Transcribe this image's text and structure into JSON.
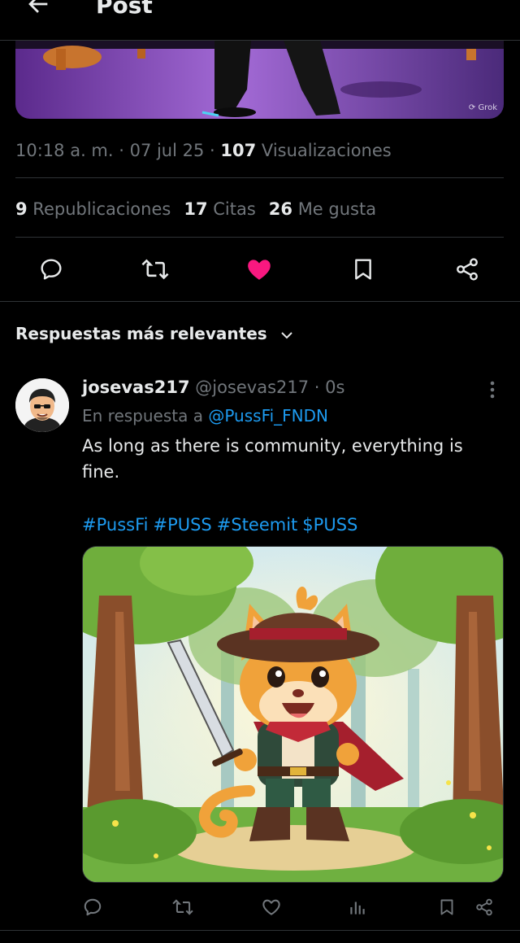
{
  "header": {
    "title": "Post",
    "back_icon": "arrow-left-icon"
  },
  "hero_image": {
    "watermark": "Grok"
  },
  "post_meta": {
    "time": "10:18 a. m.",
    "sep1": " · ",
    "date": "07 jul 25",
    "sep2": " · ",
    "views_count": "107",
    "views_label": " Visualizaciones"
  },
  "stats": {
    "reposts_count": "9",
    "reposts_label": " Republicaciones",
    "quotes_count": "17",
    "quotes_label": " Citas",
    "likes_count": "26",
    "likes_label": " Me gusta"
  },
  "actions": [
    "reply-icon",
    "repost-icon",
    "heart-filled-icon",
    "bookmark-icon",
    "share-icon"
  ],
  "colors": {
    "like": "#f91880",
    "link": "#1d9bf0",
    "muted": "#71767b",
    "text": "#e7e9ea",
    "border": "#2f3336"
  },
  "replies_sort": {
    "label": "Respuestas más relevantes"
  },
  "reply": {
    "name": "josevas217",
    "handle": " @josevas217 · 0s",
    "replying_prefix": "En respuesta a ",
    "replying_to": "@PussFi_FNDN",
    "text": "As long as there is community, everything is fine.",
    "hashtags": [
      "#PussFi",
      "#PUSS",
      "#Steemit",
      "$PUSS"
    ],
    "actions": [
      "reply-icon",
      "repost-icon",
      "heart-outline-icon",
      "analytics-icon",
      "bookmark-icon",
      "share-icon"
    ]
  }
}
